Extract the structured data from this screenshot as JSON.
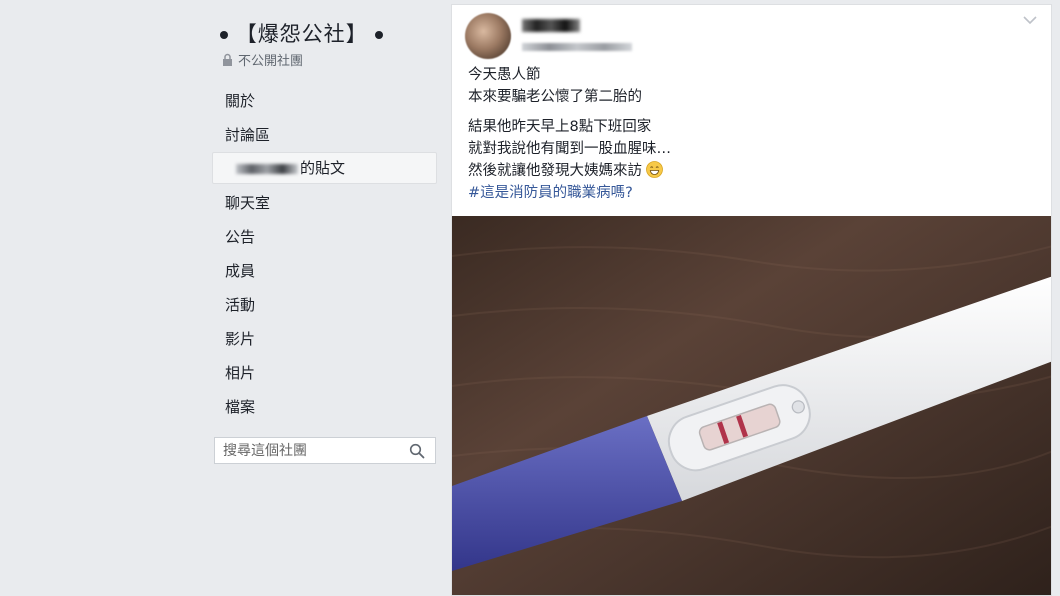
{
  "group": {
    "title_open": "【",
    "name": "爆怨公社",
    "title_close": "】",
    "privacy": "不公開社團"
  },
  "nav": {
    "items": [
      {
        "label": "關於"
      },
      {
        "label": "討論區"
      },
      {
        "label": "的貼文",
        "active": true
      },
      {
        "label": "聊天室"
      },
      {
        "label": "公告"
      },
      {
        "label": "成員"
      },
      {
        "label": "活動"
      },
      {
        "label": "影片"
      },
      {
        "label": "相片"
      },
      {
        "label": "檔案"
      }
    ]
  },
  "search": {
    "placeholder": "搜尋這個社團",
    "value": ""
  },
  "post": {
    "lines_1": [
      "今天愚人節",
      "本來要騙老公懷了第二胎的"
    ],
    "lines_2": [
      "結果他昨天早上8點下班回家",
      "就對我說他有聞到一股血腥味…",
      "然後就讓他發現大姨媽來訪"
    ],
    "hashtag": "#這是消防員的職業病嗎?",
    "emoji": "grinning-face-icon"
  },
  "colors": {
    "background": "#e9ebee",
    "link": "#365899",
    "test_blue": "#4b4fa6"
  }
}
